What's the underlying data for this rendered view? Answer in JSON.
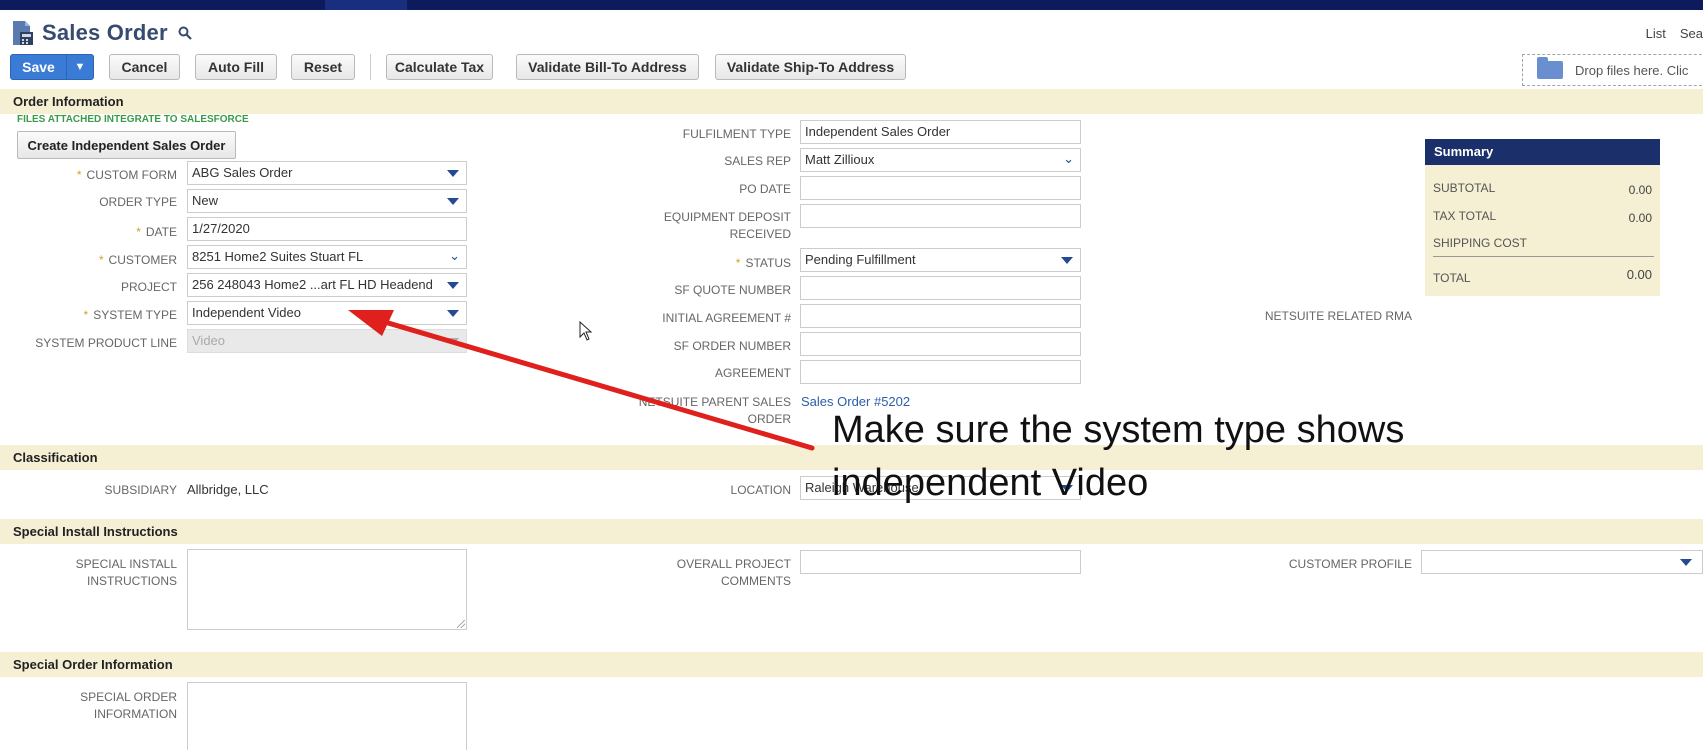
{
  "title": "Sales Order",
  "top_links": [
    "List",
    "Sea"
  ],
  "toolbar": {
    "save": "Save",
    "cancel": "Cancel",
    "auto_fill": "Auto Fill",
    "reset": "Reset",
    "calculate_tax": "Calculate Tax",
    "validate_bill": "Validate Bill-To Address",
    "validate_ship": "Validate Ship-To Address"
  },
  "dropzone": "Drop files here. Clic",
  "sections": {
    "order_info": "Order Information",
    "classification": "Classification",
    "special_install": "Special Install Instructions",
    "special_order": "Special Order Information"
  },
  "order_info": {
    "files_note": "FILES ATTACHED INTEGRATE TO SALESFORCE",
    "create_button": "Create Independent Sales Order",
    "custom_form": {
      "label": "CUSTOM FORM",
      "value": "ABG Sales Order"
    },
    "order_type": {
      "label": "ORDER TYPE",
      "value": "New"
    },
    "date": {
      "label": "DATE",
      "value": "1/27/2020"
    },
    "customer": {
      "label": "CUSTOMER",
      "value": "8251 Home2 Suites Stuart FL"
    },
    "project": {
      "label": "PROJECT",
      "value": "256 248043 Home2 ...art FL HD Headend"
    },
    "system_type": {
      "label": "SYSTEM TYPE",
      "value": "Independent Video"
    },
    "system_product_line": {
      "label": "SYSTEM PRODUCT LINE",
      "value": "Video"
    },
    "fulfilment_type": {
      "label": "FULFILMENT TYPE",
      "value": "Independent Sales Order"
    },
    "sales_rep": {
      "label": "SALES REP",
      "value": "Matt Zillioux"
    },
    "po_date": {
      "label": "PO DATE",
      "value": ""
    },
    "equipment_deposit_1": "EQUIPMENT DEPOSIT",
    "equipment_deposit_2": "RECEIVED",
    "status": {
      "label": "STATUS",
      "value": "Pending Fulfillment"
    },
    "sf_quote": {
      "label": "SF QUOTE NUMBER",
      "value": ""
    },
    "initial_agreement": {
      "label": "INITIAL AGREEMENT #",
      "value": ""
    },
    "sf_order": {
      "label": "SF ORDER NUMBER",
      "value": ""
    },
    "agreement": {
      "label": "AGREEMENT",
      "value": ""
    },
    "parent_so_1": "NETSUITE PARENT SALES",
    "parent_so_2": "ORDER",
    "parent_so_value": "Sales Order #5202",
    "related_rma": "NETSUITE RELATED RMA"
  },
  "summary": {
    "header": "Summary",
    "subtotal": {
      "label": "SUBTOTAL",
      "value": "0.00"
    },
    "tax_total": {
      "label": "TAX TOTAL",
      "value": "0.00"
    },
    "shipping": {
      "label": "SHIPPING COST",
      "value": ""
    },
    "total": {
      "label": "TOTAL",
      "value": "0.00"
    }
  },
  "classification": {
    "subsidiary": {
      "label": "SUBSIDIARY",
      "value": "Allbridge, LLC"
    },
    "location": {
      "label": "LOCATION",
      "value": "Raleigh Warehouse"
    }
  },
  "special_install": {
    "instructions_1": "SPECIAL INSTALL",
    "instructions_2": "INSTRUCTIONS",
    "overall_1": "OVERALL PROJECT",
    "overall_2": "COMMENTS",
    "customer_profile": "CUSTOMER PROFILE"
  },
  "special_order": {
    "info_1": "SPECIAL ORDER",
    "info_2": "INFORMATION"
  },
  "annotation": {
    "line1": "Make sure the system type shows",
    "line2": "independent Video",
    "arrow_color": "#e0201c"
  }
}
